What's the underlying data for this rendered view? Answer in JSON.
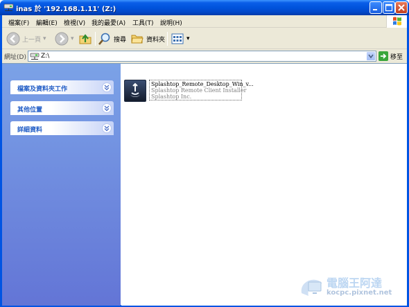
{
  "window": {
    "title": "inas 於 '192.168.1.11' (Z:)"
  },
  "menu": {
    "items": [
      "檔案(F)",
      "編輯(E)",
      "檢視(V)",
      "我的最愛(A)",
      "工具(T)",
      "說明(H)"
    ]
  },
  "toolbar": {
    "back_label": "上一頁",
    "search_label": "搜尋",
    "folders_label": "資料夾"
  },
  "address": {
    "label": "網址(D)",
    "value": "Z:\\",
    "go_label": "移至"
  },
  "taskpane": {
    "groups": [
      "檔案及資料夾工作",
      "其他位置",
      "詳細資料"
    ]
  },
  "files": [
    {
      "name": "Splashtop_Remote_Desktop_Win_v...",
      "description": "Splashtop Remote Client Installer",
      "company": "Splashtop Inc."
    }
  ],
  "watermark": {
    "brand": "電腦王阿達",
    "url": "kocpc.pixnet.net"
  },
  "colors": {
    "titlebar": "#0054e3",
    "taskpane_top": "#7ba2e7",
    "taskpane_bottom": "#6375d6",
    "group_label": "#215dc6"
  },
  "icons": {
    "title": "network-drive-icon",
    "back": "back-arrow-icon",
    "forward": "forward-arrow-icon",
    "up": "up-folder-icon",
    "search": "search-icon",
    "folders": "folders-icon",
    "views": "views-icon",
    "go": "go-arrow-icon",
    "file": "splashtop-app-icon"
  }
}
